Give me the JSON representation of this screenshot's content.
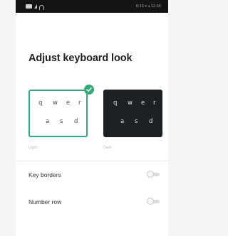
{
  "status_bar": {
    "left_icons": [
      "sim-card-icon",
      "signal-icon",
      "wifi-icon"
    ],
    "right_text": "8:30 ▾ ◂ 12:00"
  },
  "screen": {
    "title": "Adjust keyboard look"
  },
  "themes": [
    {
      "name": "Light",
      "selected": true,
      "row1": [
        "q",
        "w",
        "e",
        "r"
      ],
      "row2": [
        "a",
        "s",
        "d"
      ]
    },
    {
      "name": "Dark",
      "selected": false,
      "row1": [
        "q",
        "w",
        "e",
        "r"
      ],
      "row2": [
        "a",
        "s",
        "d"
      ]
    }
  ],
  "settings": [
    {
      "label": "Key borders",
      "enabled": false
    },
    {
      "label": "Number row",
      "enabled": false
    }
  ],
  "colors": {
    "accent": "#34a87a",
    "dark_keyboard": "#1e2124",
    "status_bar": "#141414"
  }
}
